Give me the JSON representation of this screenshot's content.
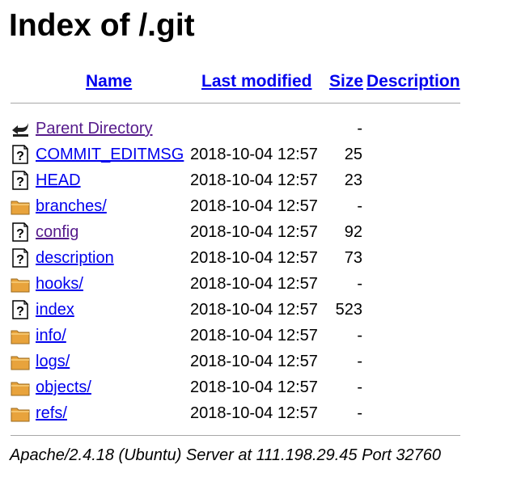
{
  "page": {
    "title": "Index of /.git",
    "columns": {
      "name": "Name",
      "last_modified": "Last modified",
      "size": "Size",
      "description": "Description"
    },
    "parent": {
      "label": "Parent Directory",
      "size": "-",
      "icon": "back-icon"
    },
    "entries": [
      {
        "name": "COMMIT_EDITMSG",
        "modified": "2018-10-04 12:57",
        "size": "25",
        "icon": "unknown-file-icon"
      },
      {
        "name": "HEAD",
        "modified": "2018-10-04 12:57",
        "size": "23",
        "icon": "unknown-file-icon"
      },
      {
        "name": "branches/",
        "modified": "2018-10-04 12:57",
        "size": "-",
        "icon": "folder-icon"
      },
      {
        "name": "config",
        "modified": "2018-10-04 12:57",
        "size": "92",
        "icon": "unknown-file-icon",
        "visited": true
      },
      {
        "name": "description",
        "modified": "2018-10-04 12:57",
        "size": "73",
        "icon": "unknown-file-icon"
      },
      {
        "name": "hooks/",
        "modified": "2018-10-04 12:57",
        "size": "-",
        "icon": "folder-icon"
      },
      {
        "name": "index",
        "modified": "2018-10-04 12:57",
        "size": "523",
        "icon": "unknown-file-icon"
      },
      {
        "name": "info/",
        "modified": "2018-10-04 12:57",
        "size": "-",
        "icon": "folder-icon"
      },
      {
        "name": "logs/",
        "modified": "2018-10-04 12:57",
        "size": "-",
        "icon": "folder-icon"
      },
      {
        "name": "objects/",
        "modified": "2018-10-04 12:57",
        "size": "-",
        "icon": "folder-icon"
      },
      {
        "name": "refs/",
        "modified": "2018-10-04 12:57",
        "size": "-",
        "icon": "folder-icon"
      }
    ],
    "footer": "Apache/2.4.18 (Ubuntu) Server at 111.198.29.45 Port 32760"
  },
  "colors": {
    "link": "#0000ee",
    "visited": "#551a8b",
    "folder": "#e8a33c"
  }
}
